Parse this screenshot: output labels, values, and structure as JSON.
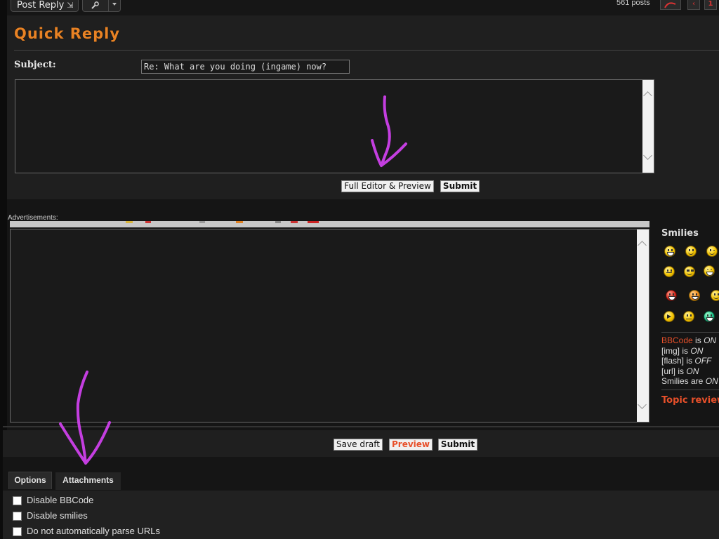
{
  "toolbar": {
    "post_reply_label": "Post Reply",
    "external_glyph": "⇲",
    "tools_icon": "wrench-icon",
    "post_count": "561 posts",
    "current_page": "1"
  },
  "quick_reply": {
    "title": "Quick Reply",
    "subject_label": "Subject:",
    "subject_value": "Re: What are you doing (ingame) now?",
    "full_editor_label": "Full Editor & Preview",
    "submit_label": "Submit"
  },
  "ads_label": "Advertisements:",
  "editor": {
    "save_draft_label": "Save draft",
    "preview_label": "Preview",
    "submit_label": "Submit"
  },
  "sidebar": {
    "smilies_title": "Smilies",
    "smilies": [
      "very-happy-icon",
      "smile-icon",
      "wink-icon",
      "confused-icon",
      "cool-icon",
      "laughing-icon",
      "evil-icon",
      "twisted-evil-icon",
      "eek-icon",
      "arrow-icon",
      "neutral-icon",
      "green-grin-icon"
    ],
    "status": {
      "bbcode_link": "BBCode",
      "is": "is",
      "bbcode_state": "ON",
      "img_label": "[img] is",
      "img_state": "ON",
      "flash_label": "[flash] is",
      "flash_state": "OFF",
      "url_label": "[url] is",
      "url_state": "ON",
      "smilies_label": "Smilies are",
      "smilies_state": "ON"
    },
    "topic_review": "Topic review"
  },
  "tabs": [
    {
      "label": "Options"
    },
    {
      "label": "Attachments"
    }
  ],
  "options": [
    {
      "label": "Disable BBCode",
      "checked": false
    },
    {
      "label": "Disable smilies",
      "checked": false
    },
    {
      "label": "Do not automatically parse URLs",
      "checked": false
    }
  ],
  "colors": {
    "title_orange": "#e88224",
    "link_red": "#e8502a",
    "annotation_magenta": "#c43ee0"
  }
}
